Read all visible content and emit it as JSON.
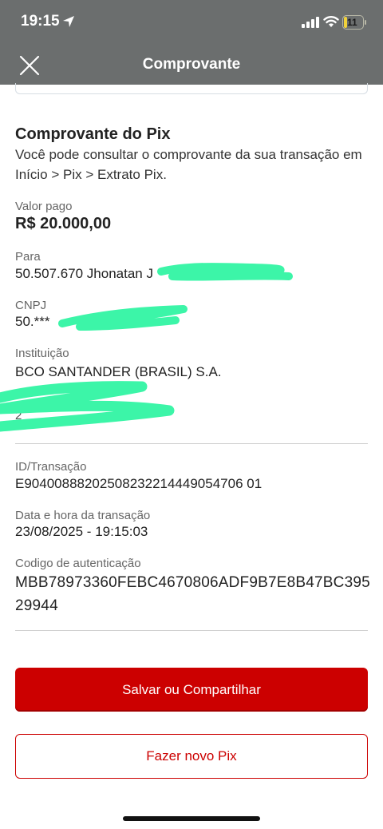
{
  "status_bar": {
    "time": "19:15",
    "battery": "11"
  },
  "nav": {
    "title": "Comprovante"
  },
  "receipt": {
    "title": "Comprovante do Pix",
    "description": "Você pode consultar o comprovante da sua transação em Início > Pix > Extrato Pix.",
    "valor_pago_label": "Valor pago",
    "valor_pago_value": "R$ 20.000,00",
    "para_label": "Para",
    "para_value": "50.507.670 Jhonatan J",
    "cnpj_label": "CNPJ",
    "cnpj_value": "50.***",
    "instituicao_label": "Instituição",
    "instituicao_value": "BCO SANTANDER (BRASIL) S.A.",
    "hidden_partial": "2",
    "id_label": "ID/Transação",
    "id_value": "E90400888202508232214449054706 01",
    "data_label": "Data e hora da transação",
    "data_value": "23/08/2025 - 19:15:03",
    "auth_label": "Codigo de autenticação",
    "auth_value": "MBB78973360FEBC4670806ADF9B7E8B47BC39529944"
  },
  "buttons": {
    "save_share": "Salvar ou Compartilhar",
    "new_pix": "Fazer novo Pix"
  },
  "colors": {
    "brand_red": "#cc0000",
    "redaction_green": "#3cf5a8",
    "header_gray": "#6b6e6e"
  }
}
